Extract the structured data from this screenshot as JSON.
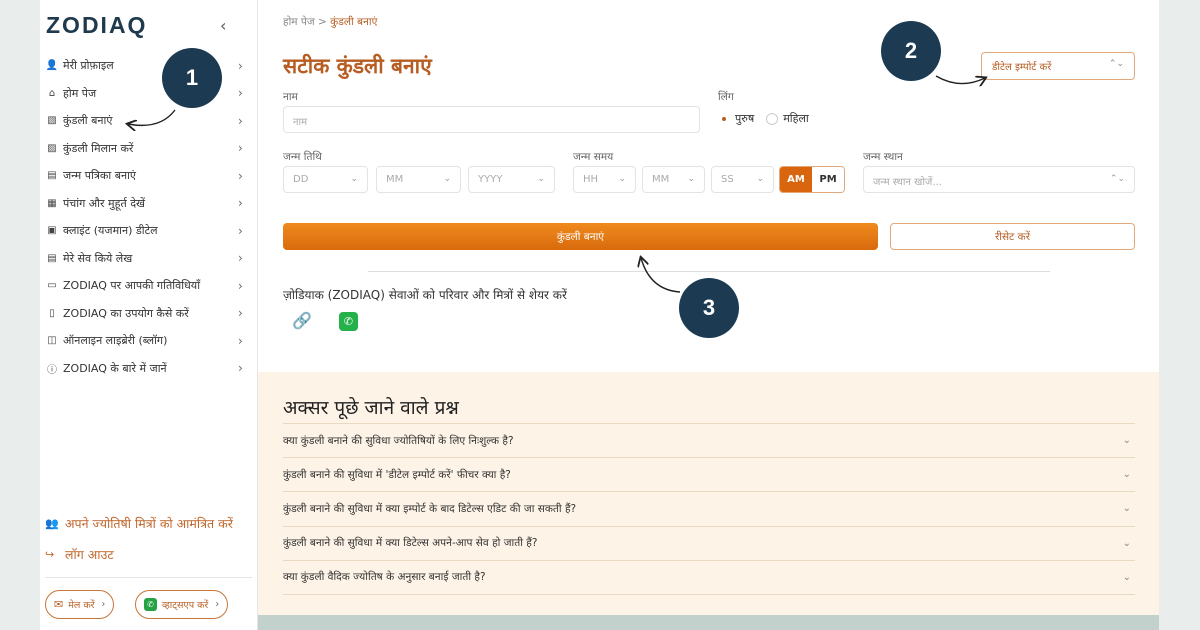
{
  "sidebar": {
    "logo": "ZODIAQ",
    "collapse_icon": "‹",
    "items": [
      {
        "icon": "user-icon",
        "glyph": "👤",
        "label": "मेरी प्रोफ़ाइल"
      },
      {
        "icon": "home-icon",
        "glyph": "⌂",
        "label": "होम पेज"
      },
      {
        "icon": "chart-icon",
        "glyph": "▧",
        "label": "कुंडली बनाएं"
      },
      {
        "icon": "match-icon",
        "glyph": "▨",
        "label": "कुंडली मिलान करें"
      },
      {
        "icon": "document-icon",
        "glyph": "▤",
        "label": "जन्म पत्रिका बनाएं"
      },
      {
        "icon": "calendar-icon",
        "glyph": "▦",
        "label": "पंचांग और मुहूर्त देखें"
      },
      {
        "icon": "id-card-icon",
        "glyph": "▣",
        "label": "क्लाइंट (यजमान) डीटेल"
      },
      {
        "icon": "saved-icon",
        "glyph": "▤",
        "label": "मेरे सेव किये लेख"
      },
      {
        "icon": "laptop-icon",
        "glyph": "▭",
        "label": "ZODIAQ पर आपकी गतिविधियाँ"
      },
      {
        "icon": "book-icon",
        "glyph": "▯",
        "label": "ZODIAQ का उपयोग कैसे करें"
      },
      {
        "icon": "open-book-icon",
        "glyph": "◫",
        "label": "ऑनलाइन लाइब्रेरी (ब्लॉग)"
      },
      {
        "icon": "info-icon",
        "glyph": "ⓘ",
        "label": "ZODIAQ के बारे में जानें"
      }
    ],
    "invite_label": "अपने ज्योतिषी मित्रों को आमंत्रित करें",
    "logout_label": "लॉग आउट",
    "mail_label": "मेल करें",
    "whatsapp_label": "व्हाट्सएप करें"
  },
  "breadcrumb": {
    "home": "होम पेज",
    "separator": ">",
    "current": "कुंडली बनाएं"
  },
  "page_title": "सटीक कुंडली बनाएं",
  "import_select": {
    "value": "डीटेल इम्पोर्ट करें"
  },
  "form": {
    "name_label": "नाम",
    "name_placeholder": "नाम",
    "gender_label": "लिंग",
    "gender_options": [
      "पुरुष",
      "महिला"
    ],
    "dob_label": "जन्म तिथि",
    "dob_day": "DD",
    "dob_month": "MM",
    "dob_year": "YYYY",
    "tob_label": "जन्म समय",
    "tob_hour": "HH",
    "tob_min": "MM",
    "tob_sec": "SS",
    "am": "AM",
    "pm": "PM",
    "pob_label": "जन्म स्थान",
    "pob_placeholder": "जन्म स्थान खोजें...",
    "submit_label": "कुंडली बनाएं",
    "reset_label": "रीसेट करें"
  },
  "share": {
    "text": "ज़ोडियाक (ZODIAQ) सेवाओं को परिवार और मित्रों से शेयर करें"
  },
  "faq": {
    "title": "अक्सर पूछे जाने वाले प्रश्न",
    "items": [
      "क्या कुंडली बनाने की सुविधा ज्योतिषियों के लिए निःशुल्क है?",
      "कुंडली बनाने की सुविधा में 'डीटेल इम्पोर्ट करें' फीचर क्या है?",
      "कुंडली बनाने की सुविधा में क्या इम्पोर्ट के बाद डिटेल्स एडिट की जा सकती हैं?",
      "कुंडली बनाने की सुविधा में क्या डिटेल्स अपने-आप सेव हो जाती हैं?",
      "क्या कुंडली वैदिक ज्योतिष के अनुसार बनाई जाती है?"
    ]
  },
  "annotations": {
    "one": "1",
    "two": "2",
    "three": "3"
  },
  "colors": {
    "brand": "#b75d22",
    "primary": "#e67a14",
    "badge": "#1c3b52",
    "faq_bg": "#fdf3e6"
  }
}
